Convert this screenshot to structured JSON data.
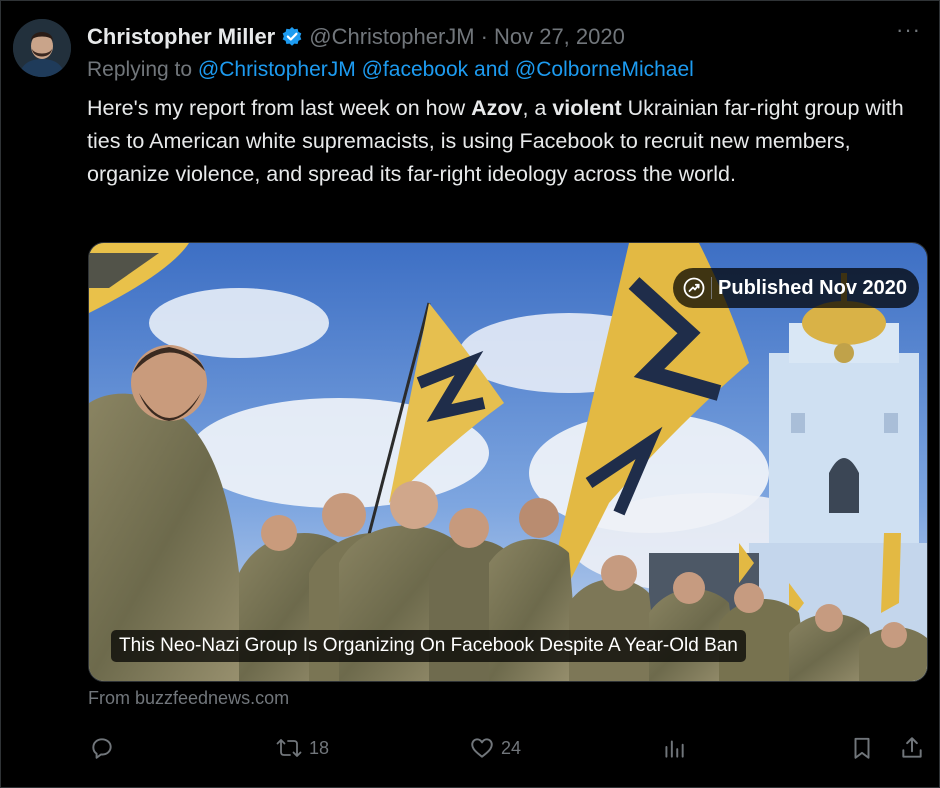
{
  "tweet": {
    "author_name": "Christopher Miller",
    "handle": "@ChristopherJM",
    "separator": "·",
    "date": "Nov 27, 2020",
    "more_label": "···",
    "verified_color": "#1d9bf0",
    "replying_prefix": "Replying to",
    "reply_mention_1": "@ChristopherJM",
    "reply_mention_2": "@facebook",
    "reply_and": "and",
    "reply_mention_3": "@ColborneMichael",
    "text": {
      "p1": "Here's my report from last week on how ",
      "b1": "Azov",
      "p2": ", a ",
      "b2": "violent",
      "p3": " Ukrainian far-right group with ties to American white supremacists, is using Facebook to recruit new members, organize violence, and spread its far-right ideology across the world."
    }
  },
  "card": {
    "badge_icon": "trending-arrow-icon",
    "badge_text": "Published Nov 2020",
    "caption": "This Neo-Nazi Group Is Organizing On Facebook Despite A Year-Old Ban",
    "source": "From buzzfeednews.com"
  },
  "actions": {
    "reply_icon": "reply-bubble-icon",
    "retweet_icon": "retweet-icon",
    "retweets": "18",
    "like_icon": "heart-icon",
    "likes": "24",
    "views_icon": "bar-chart-icon",
    "bookmark_icon": "bookmark-icon",
    "share_icon": "share-icon"
  },
  "colors": {
    "background": "#000000",
    "text": "#e7e9ea",
    "muted": "#71767b",
    "link": "#1d9bf0"
  }
}
